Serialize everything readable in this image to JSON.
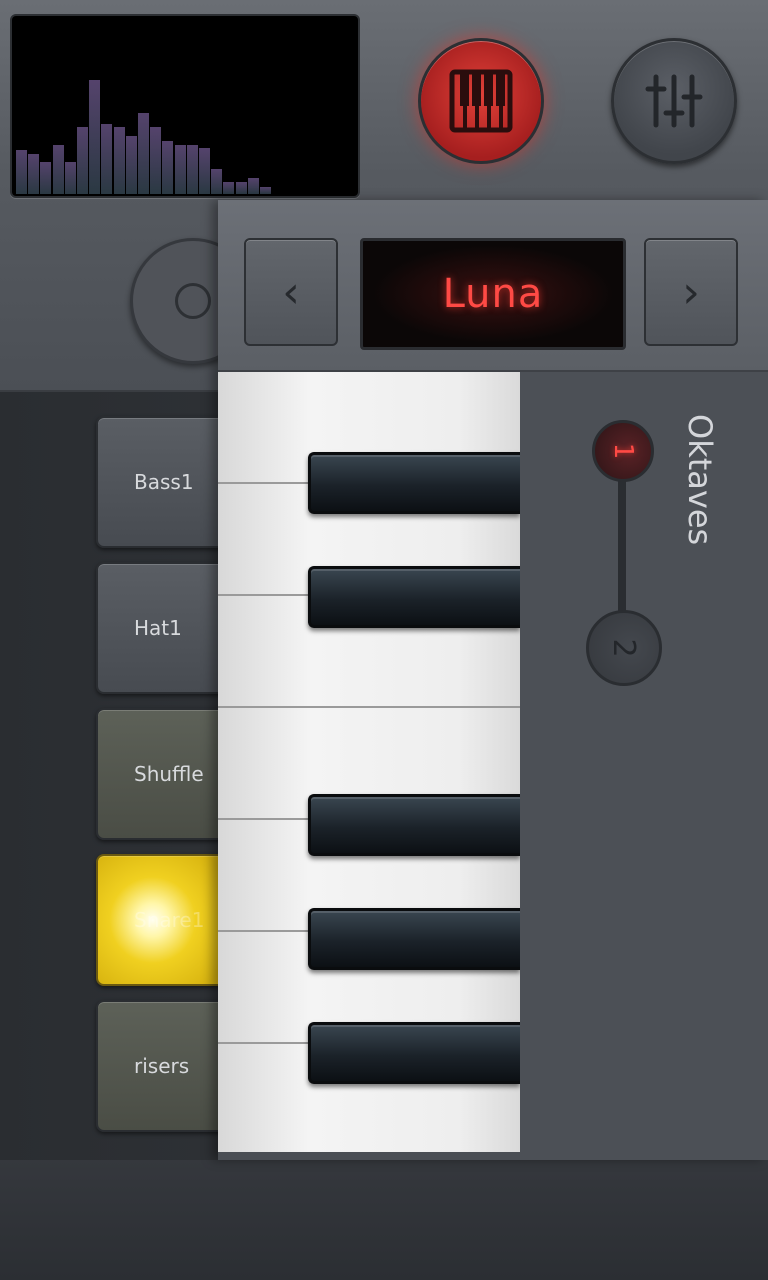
{
  "instrument": {
    "name": "Luna",
    "prev_symbol": "‹",
    "next_symbol": "›"
  },
  "pads": [
    {
      "label": "Bass1"
    },
    {
      "label": "Hat1"
    },
    {
      "label": "Shuffle"
    },
    {
      "label": "Snare1"
    },
    {
      "label": "risers"
    }
  ],
  "octaves": {
    "label": "Oktaves",
    "options": [
      "1",
      "2"
    ],
    "selected": "1"
  },
  "analyzer": {
    "levels": [
      0.25,
      0.23,
      0.18,
      0.28,
      0.18,
      0.38,
      0.65,
      0.4,
      0.38,
      0.33,
      0.46,
      0.38,
      0.3,
      0.28,
      0.28,
      0.26,
      0.14,
      0.07,
      0.07,
      0.09,
      0.04
    ]
  },
  "icons": {
    "piano": "piano-icon",
    "mixer": "mixer-sliders-icon",
    "prev": "chevron-left-icon",
    "next": "chevron-right-icon"
  },
  "colors": {
    "accent_red": "#ff4a45",
    "pad_active": "#f0d020",
    "panel": "#4a4e54"
  }
}
